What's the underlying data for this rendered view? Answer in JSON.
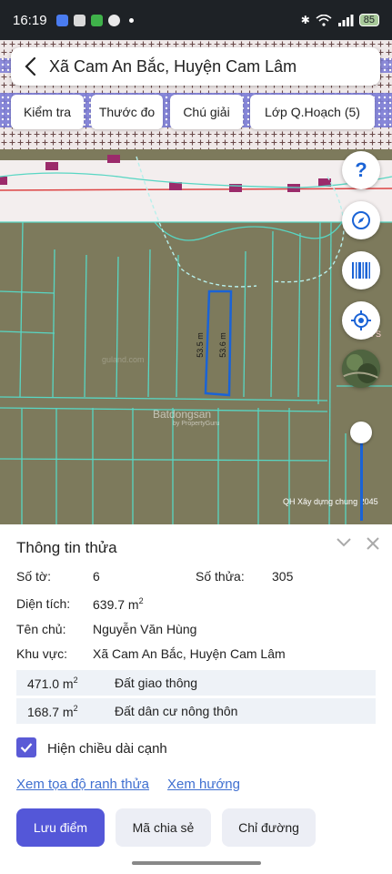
{
  "status_bar": {
    "time": "16:19",
    "battery": "85"
  },
  "header": {
    "title": "Xã Cam An Bắc, Huyện Cam Lâm"
  },
  "tools": [
    "Kiểm tra",
    "Thước đo",
    "Chú giải",
    "Lớp Q.Hoạch (5)"
  ],
  "map": {
    "dimension_left": "53.5 m",
    "dimension_right": "53.6 m",
    "watermark_main": "Batdongsan",
    "watermark_sub": "by PropertyGuru",
    "plan_label": "QH Xây dựng chung 2045",
    "faint_label": "guland.com",
    "edge_label": "Bắc S"
  },
  "panel": {
    "title": "Thông tin thửa",
    "so_to_label": "Số tờ:",
    "so_to": "6",
    "so_thua_label": "Số thửa:",
    "so_thua": "305",
    "dien_tich_label": "Diện tích:",
    "dien_tich": "639.7 m",
    "ten_chu_label": "Tên chủ:",
    "ten_chu": "Nguyễn Văn Hùng",
    "khu_vuc_label": "Khu vực:",
    "khu_vuc": "Xã Cam An Bắc, Huyện Cam Lâm",
    "land_use": [
      {
        "area": "471.0 m",
        "type": "Đất giao thông"
      },
      {
        "area": "168.7 m",
        "type": "Đất dân cư nông thôn"
      }
    ],
    "checkbox_label": "Hiện chiều dài cạnh",
    "link_coords": "Xem tọa độ ranh thửa",
    "link_direction": "Xem hướng",
    "btn_save": "Lưu điểm",
    "btn_share": "Mã chia sẻ",
    "btn_route": "Chỉ đường"
  },
  "colors": {
    "accent": "#5457d8",
    "parcel": "#1a63d6",
    "link": "#3f6fd0"
  }
}
